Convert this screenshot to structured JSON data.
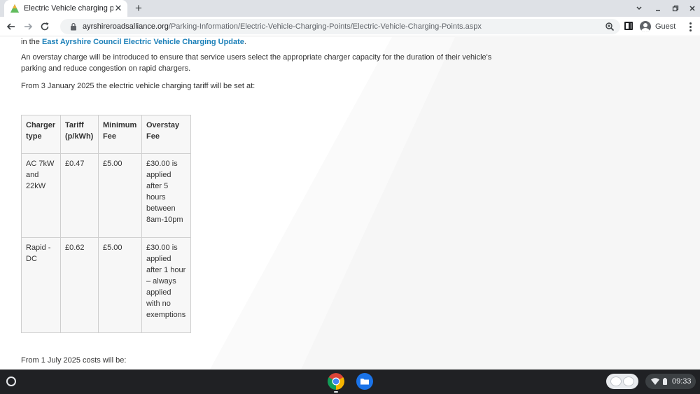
{
  "browser": {
    "tab_title": "Electric Vehicle charging points",
    "tab_close": "✕",
    "new_tab": "+",
    "url_host": "ayrshireroadsalliance.org",
    "url_path": "/Parking-Information/Electric-Vehicle-Charging-Points/Electric-Vehicle-Charging-Points.aspx",
    "profile_label": "Guest"
  },
  "page": {
    "p1_prefix": "in the ",
    "p1_link": "East Ayrshire Council  Electric Vehicle Charging Update",
    "p1_suffix": ".",
    "p2": "An overstay charge will be introduced to ensure that service users select the appropriate charger capacity for the duration of their vehicle's parking and reduce congestion on rapid chargers.",
    "p3": "From 3 January 2025 the electric vehicle charging tariff will be set at:",
    "p4": "From 1 July 2025 costs will be:",
    "table": {
      "headers": [
        "Charger type",
        "Tariff (p/kWh)",
        "Minimum Fee",
        "Overstay Fee"
      ],
      "rows": [
        [
          "AC 7kW and 22kW",
          "£0.47",
          "£5.00",
          "£30.00 is applied after 5 hours between 8am-10pm"
        ],
        [
          "Rapid - DC",
          "£0.62",
          "£5.00",
          "£30.00 is applied after 1 hour – always applied with no exemptions"
        ]
      ]
    }
  },
  "shelf": {
    "time": "09:33"
  },
  "colors": {
    "link": "#1a7fb8",
    "text": "#333333",
    "table_bg": "#f7f7f7",
    "shelf_bg": "#202124"
  }
}
